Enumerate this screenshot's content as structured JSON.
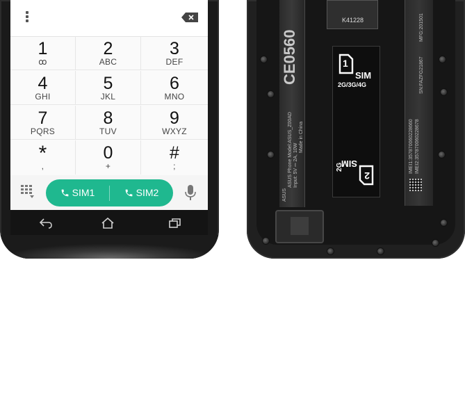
{
  "dialer": {
    "keys": [
      {
        "digit": "1",
        "letters": "ꝏ"
      },
      {
        "digit": "2",
        "letters": "ABC"
      },
      {
        "digit": "3",
        "letters": "DEF"
      },
      {
        "digit": "4",
        "letters": "GHI"
      },
      {
        "digit": "5",
        "letters": "JKL"
      },
      {
        "digit": "6",
        "letters": "MNO"
      },
      {
        "digit": "7",
        "letters": "PQRS"
      },
      {
        "digit": "8",
        "letters": "TUV"
      },
      {
        "digit": "9",
        "letters": "WXYZ"
      },
      {
        "digit": "*",
        "letters": ","
      },
      {
        "digit": "0",
        "letters": "+"
      },
      {
        "digit": "#",
        "letters": ";"
      }
    ],
    "sim1_label": "SIM1",
    "sim2_label": "SIM2",
    "accent_color": "#1fb88f",
    "icons": [
      "overflow-menu-icon",
      "backspace-icon",
      "dialpad-icon",
      "phone-icon",
      "microphone-icon",
      "back-icon",
      "home-icon",
      "recent-apps-icon"
    ]
  },
  "phone_back": {
    "sim_slot_1": {
      "number": "1",
      "label": "SIM",
      "bands": "2G/3G/4G"
    },
    "sim_slot_2": {
      "number": "2",
      "label": "SIM",
      "bands": "2G"
    },
    "sd_label": "K41228",
    "battery_texts": {
      "ce_mark": "CE0560",
      "brand": "ASUS",
      "model": "ASUS Phone  Model:ASUS_Z00AD",
      "input": "Input: 5V ⎓ 2A, 10W",
      "made_in": "Made in China",
      "imei1": "IMEI1:357870060228660",
      "imei2": "IMEI2:357870060228678",
      "sn": "SN:FAZFG21867",
      "mfg": "MFG:201501"
    }
  }
}
